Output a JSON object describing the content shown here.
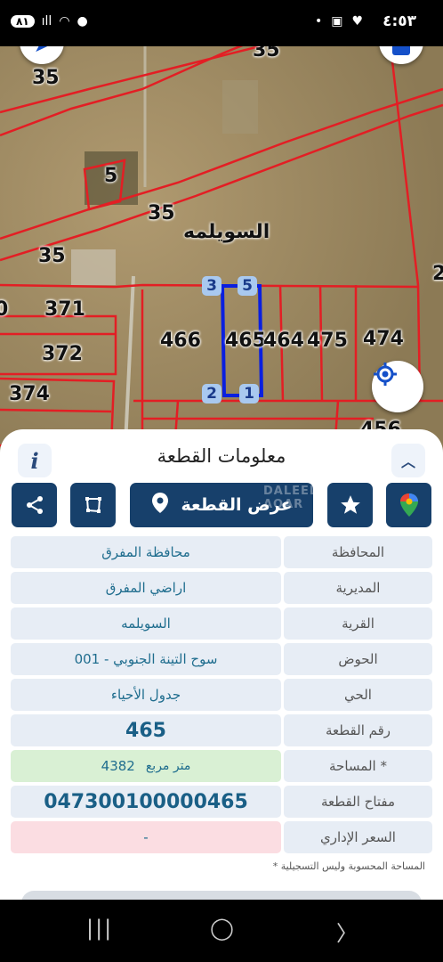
{
  "status_bar": {
    "time": "٤:٥٣",
    "battery": "٨١"
  },
  "map": {
    "village_name": "السويلمه",
    "plot_labels": [
      "35",
      "35",
      "5",
      "35",
      "35",
      "371",
      "372",
      "374",
      "466",
      "465",
      "464",
      "475",
      "474",
      "456",
      "2",
      "0"
    ],
    "vertices": [
      "3",
      "5",
      "2",
      "1"
    ]
  },
  "sheet": {
    "title": "معلومات القطعة",
    "show_plot_label": "عرض القطعة",
    "watermark": "DALEEL AQAR",
    "fields": [
      {
        "label": "المحافظة",
        "value": "محافظة المفرق"
      },
      {
        "label": "المديرية",
        "value": "اراضي المفرق"
      },
      {
        "label": "القرية",
        "value": "السويلمه"
      },
      {
        "label": "الحوض",
        "value": "سوح التينة الجنوبي - 001"
      },
      {
        "label": "الحي",
        "value": "جدول الأحياء"
      },
      {
        "label": "رقم القطعة",
        "value": "465"
      },
      {
        "label": "المساحة *",
        "value": "4382",
        "unit": "متر مربع"
      },
      {
        "label": "مفتاح القطعة",
        "value": "047300100000465"
      },
      {
        "label": "السعر الإداري",
        "value": "-"
      }
    ],
    "footnote": "* المساحة المحسوبة وليس التسجيلية"
  },
  "colors": {
    "primary": "#17406b",
    "parcel_line": "#e31e24",
    "selected_parcel": "#0a1fe0"
  }
}
